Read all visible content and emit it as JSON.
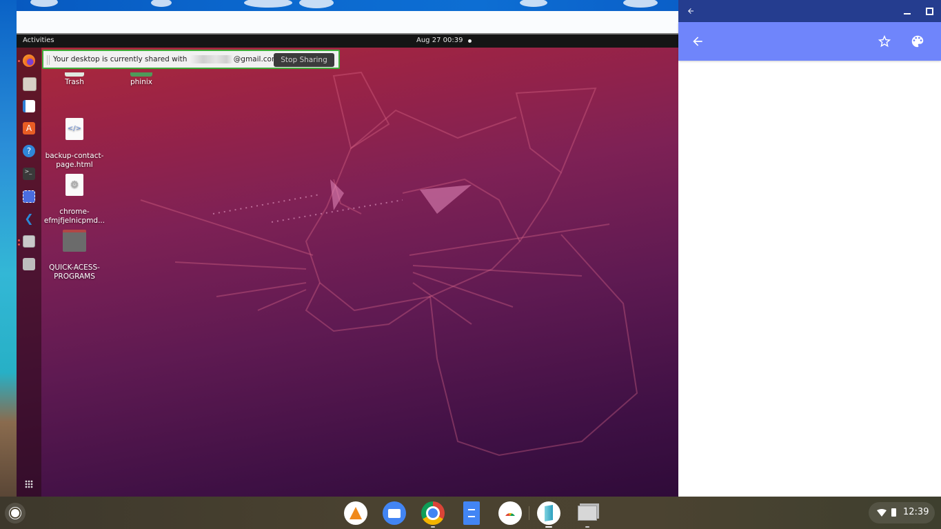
{
  "ubuntu": {
    "topbar": {
      "activities": "Activities",
      "clock": "Aug 27  00:39"
    },
    "share_bar": {
      "message_prefix": "Your desktop is currently shared with",
      "message_suffix": "@gmail.com.",
      "stop_label": "Stop Sharing"
    },
    "dock": {
      "items": [
        {
          "name": "firefox",
          "icon": "firefox-icon",
          "color": "#e8662a",
          "running": true
        },
        {
          "name": "files",
          "icon": "files-icon",
          "color": "#d8d0c6",
          "running": false
        },
        {
          "name": "libreoffice-writer",
          "icon": "writer-icon",
          "color": "#2f7fd3",
          "running": false
        },
        {
          "name": "ubuntu-software",
          "icon": "software-icon",
          "color": "#e85d24",
          "running": false
        },
        {
          "name": "help",
          "icon": "help-icon",
          "color": "#2f86d8",
          "running": false
        },
        {
          "name": "terminal",
          "icon": "terminal-icon",
          "color": "#3a3a3a",
          "running": false
        },
        {
          "name": "screenshot",
          "icon": "screenshot-icon",
          "color": "#4a6de0",
          "running": false
        },
        {
          "name": "vscode",
          "icon": "vscode-icon",
          "color": "#2a8ad8",
          "running": false
        },
        {
          "name": "chrome-remote-desktop",
          "icon": "remote-desktop-icon",
          "color": "#c9c9c9",
          "running": true
        },
        {
          "name": "disc",
          "icon": "disc-icon",
          "color": "#bdbdbd",
          "running": false
        }
      ],
      "apps_grid_icon": "show-applications-icon"
    },
    "desktop_icons": [
      {
        "label": "Trash",
        "type": "trash"
      },
      {
        "label": "phinix",
        "type": "folder-green"
      },
      {
        "label": "backup-contact-\npage.html",
        "type": "html-file"
      },
      {
        "label": "chrome-\nefmjfjelnicpmd...",
        "type": "settings-file"
      },
      {
        "label": "QUICK-ACESS-\nPROGRAMS",
        "type": "folder"
      }
    ]
  },
  "app_window": {
    "titlebar": {
      "back_icon": "arrow-left-icon",
      "minimize_icon": "minimize-icon",
      "maximize_icon": "maximize-icon"
    },
    "appbar": {
      "back_icon": "arrow-left-icon",
      "star_icon": "star-outline-icon",
      "palette_icon": "palette-icon"
    },
    "colors": {
      "titlebar": "#253d8f",
      "appbar": "#6f85fb"
    }
  },
  "shelf": {
    "launcher_icon": "launcher-icon",
    "apps": [
      {
        "name": "vlc",
        "icon": "vlc-icon",
        "active": false
      },
      {
        "name": "files",
        "icon": "files-icon",
        "active": false
      },
      {
        "name": "chrome",
        "icon": "chrome-icon",
        "active": true
      },
      {
        "name": "docs",
        "icon": "docs-icon",
        "active": false
      },
      {
        "name": "chrome-remote-desktop",
        "icon": "remote-desktop-icon",
        "active": false
      },
      {
        "name": "app",
        "icon": "app-icon",
        "active": true
      },
      {
        "name": "remote-desktop-window",
        "icon": "remote-desktop-window-icon",
        "active": true
      }
    ],
    "tray": {
      "wifi_icon": "wifi-icon",
      "battery_icon": "battery-icon",
      "time": "12:39"
    }
  }
}
